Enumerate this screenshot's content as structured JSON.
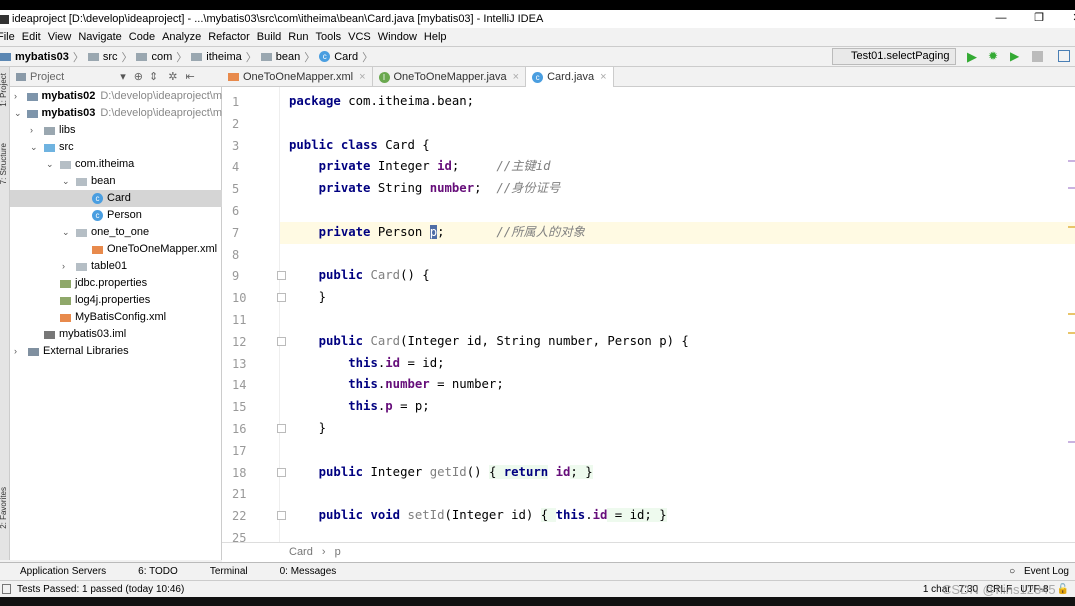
{
  "window": {
    "title": "ideaproject [D:\\develop\\ideaproject] - ...\\mybatis03\\src\\com\\itheima\\bean\\Card.java [mybatis03] - IntelliJ IDEA",
    "minimize": "—",
    "maximize": "❐",
    "close": "✕"
  },
  "menu": [
    "File",
    "Edit",
    "View",
    "Navigate",
    "Code",
    "Analyze",
    "Refactor",
    "Build",
    "Run",
    "Tools",
    "VCS",
    "Window",
    "Help"
  ],
  "breadcrumb": [
    "mybatis03",
    "src",
    "com",
    "itheima",
    "bean",
    "Card"
  ],
  "run_config": "Test01.selectPaging",
  "left_stripe": [
    "1: Project",
    "7: Structure",
    "2: Favorites"
  ],
  "project_panel": {
    "title": "Project",
    "tree": [
      {
        "label": "mybatis02",
        "path": "D:\\develop\\ideaproject\\m",
        "depth": 0,
        "arrow": "›",
        "icon": "module",
        "bold": true
      },
      {
        "label": "mybatis03",
        "path": "D:\\develop\\ideaproject\\m",
        "depth": 0,
        "arrow": "⌄",
        "icon": "module",
        "bold": true
      },
      {
        "label": "libs",
        "depth": 1,
        "arrow": "›",
        "icon": "folder"
      },
      {
        "label": "src",
        "depth": 1,
        "arrow": "⌄",
        "icon": "folder-src"
      },
      {
        "label": "com.itheima",
        "depth": 2,
        "arrow": "⌄",
        "icon": "package"
      },
      {
        "label": "bean",
        "depth": 3,
        "arrow": "⌄",
        "icon": "package"
      },
      {
        "label": "Card",
        "depth": 4,
        "icon": "class",
        "selected": true
      },
      {
        "label": "Person",
        "depth": 4,
        "icon": "class"
      },
      {
        "label": "one_to_one",
        "depth": 3,
        "arrow": "⌄",
        "icon": "package"
      },
      {
        "label": "OneToOneMapper.xml",
        "depth": 4,
        "icon": "xml"
      },
      {
        "label": "table01",
        "depth": 3,
        "arrow": "›",
        "icon": "package"
      },
      {
        "label": "jdbc.properties",
        "depth": 2,
        "icon": "properties"
      },
      {
        "label": "log4j.properties",
        "depth": 2,
        "icon": "properties"
      },
      {
        "label": "MyBatisConfig.xml",
        "depth": 2,
        "icon": "xml"
      },
      {
        "label": "mybatis03.iml",
        "depth": 1,
        "icon": "iml"
      },
      {
        "label": "External Libraries",
        "depth": 0,
        "arrow": "›",
        "icon": "libraries"
      }
    ]
  },
  "tabs": [
    {
      "label": "OneToOneMapper.xml",
      "icon": "xml"
    },
    {
      "label": "OneToOneMapper.java",
      "icon": "interface"
    },
    {
      "label": "Card.java",
      "icon": "class",
      "active": true
    }
  ],
  "code": [
    {
      "n": "1",
      "t": [
        [
          "package",
          "kw"
        ],
        [
          " com.itheima.bean;",
          ""
        ]
      ]
    },
    {
      "n": "2",
      "t": []
    },
    {
      "n": "3",
      "t": [
        [
          "public class",
          "kw"
        ],
        [
          " Card {",
          ""
        ]
      ]
    },
    {
      "n": "4",
      "t": [
        [
          "    ",
          ""
        ],
        [
          "private",
          "kw"
        ],
        [
          " Integer ",
          ""
        ],
        [
          "id",
          "fd"
        ],
        [
          ";     ",
          ""
        ],
        [
          "//主键id",
          "cm"
        ]
      ]
    },
    {
      "n": "5",
      "t": [
        [
          "    ",
          ""
        ],
        [
          "private",
          "kw"
        ],
        [
          " String ",
          ""
        ],
        [
          "number",
          "fd"
        ],
        [
          ";  ",
          ""
        ],
        [
          "//身份证号",
          "cm"
        ]
      ]
    },
    {
      "n": "6",
      "t": []
    },
    {
      "n": "7",
      "t": [
        [
          "    ",
          ""
        ],
        [
          "private",
          "kw"
        ],
        [
          " Person ",
          ""
        ],
        [
          "p",
          "hl"
        ],
        [
          ";       ",
          ""
        ],
        [
          "//所属人的对象",
          "cm"
        ]
      ],
      "current": true
    },
    {
      "n": "8",
      "t": []
    },
    {
      "n": "9",
      "t": [
        [
          "    ",
          ""
        ],
        [
          "public",
          "kw"
        ],
        [
          " ",
          ""
        ],
        [
          "Card",
          "mt"
        ],
        [
          "() {",
          ""
        ]
      ],
      "fold": true
    },
    {
      "n": "10",
      "t": [
        [
          "    }",
          ""
        ]
      ],
      "fold": true
    },
    {
      "n": "11",
      "t": []
    },
    {
      "n": "12",
      "t": [
        [
          "    ",
          ""
        ],
        [
          "public",
          "kw"
        ],
        [
          " ",
          ""
        ],
        [
          "Card",
          "mt"
        ],
        [
          "(Integer id, String number, Person p) {",
          ""
        ]
      ],
      "fold": true
    },
    {
      "n": "13",
      "t": [
        [
          "        ",
          ""
        ],
        [
          "this",
          "kw"
        ],
        [
          ".",
          ""
        ],
        [
          "id",
          "fd"
        ],
        [
          " = id;",
          ""
        ]
      ]
    },
    {
      "n": "14",
      "t": [
        [
          "        ",
          ""
        ],
        [
          "this",
          "kw"
        ],
        [
          ".",
          ""
        ],
        [
          "number",
          "fd"
        ],
        [
          " = number;",
          ""
        ]
      ]
    },
    {
      "n": "15",
      "t": [
        [
          "        ",
          ""
        ],
        [
          "this",
          "kw"
        ],
        [
          ".",
          ""
        ],
        [
          "p",
          "fd"
        ],
        [
          " = p;",
          ""
        ]
      ]
    },
    {
      "n": "16",
      "t": [
        [
          "    }",
          ""
        ]
      ],
      "fold": true
    },
    {
      "n": "17",
      "t": []
    },
    {
      "n": "18",
      "t": [
        [
          "    ",
          ""
        ],
        [
          "public",
          "kw"
        ],
        [
          " Integer ",
          ""
        ],
        [
          "getId",
          "mt"
        ],
        [
          "() ",
          ""
        ],
        [
          "{ ",
          "br"
        ],
        [
          "return",
          "kw br"
        ],
        [
          " ",
          ""
        ],
        [
          "id",
          "fd"
        ],
        [
          "; }",
          "br"
        ]
      ],
      "fold": true
    },
    {
      "n": "21",
      "t": []
    },
    {
      "n": "22",
      "t": [
        [
          "    ",
          ""
        ],
        [
          "public void",
          "kw"
        ],
        [
          " ",
          ""
        ],
        [
          "setId",
          "mt"
        ],
        [
          "(Integer id) ",
          ""
        ],
        [
          "{ ",
          "br"
        ],
        [
          "this",
          "kw"
        ],
        [
          ".",
          ""
        ],
        [
          "id",
          "fd"
        ],
        [
          " = id; }",
          "br"
        ]
      ],
      "fold": true
    },
    {
      "n": "25",
      "t": []
    }
  ],
  "editor_breadcrumb": [
    "Card",
    "p"
  ],
  "tool_tabs": [
    "Application Servers",
    "6: TODO",
    "Terminal",
    "0: Messages"
  ],
  "event_log": "Event Log",
  "status": {
    "message": "Tests Passed: 1 passed (today 10:46)",
    "selection": "1 char",
    "position": "7:30",
    "line_sep": "CRLF",
    "encoding": "UTF-8",
    "watermark": "CSDN @hins12345"
  }
}
